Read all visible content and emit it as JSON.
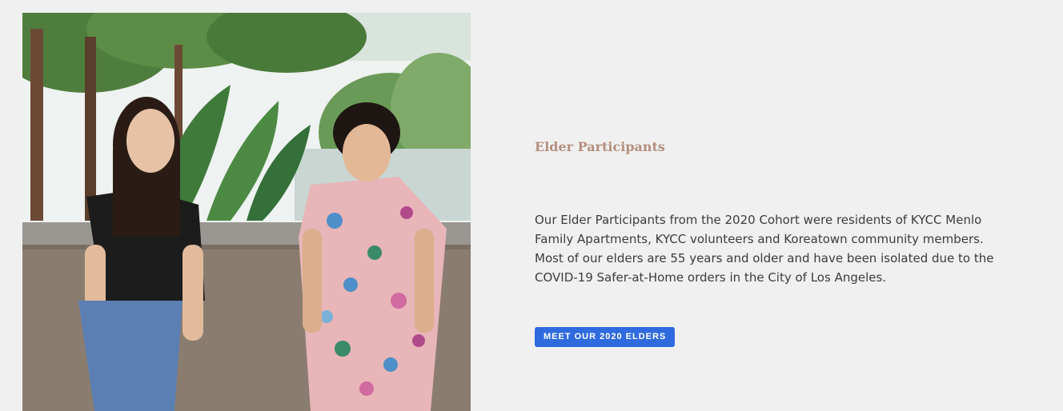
{
  "section": {
    "title": "Elder Participants",
    "body": "Our Elder Participants from the 2020 Cohort were residents of KYCC Menlo Family Apartments, KYCC volunteers and Koreatown community members. Most of our elders are 55 years and older and have been isolated due to the COVID-19 Safer-at-Home orders in the City of Los Angeles.",
    "button_label": "MEET OUR 2020 ELDERS"
  },
  "colors": {
    "page_background": "#f0f0f0",
    "title": "#b58e7e",
    "body_text": "#3c3c3c",
    "button_background": "#2f6bdf",
    "button_text": "#ffffff"
  }
}
